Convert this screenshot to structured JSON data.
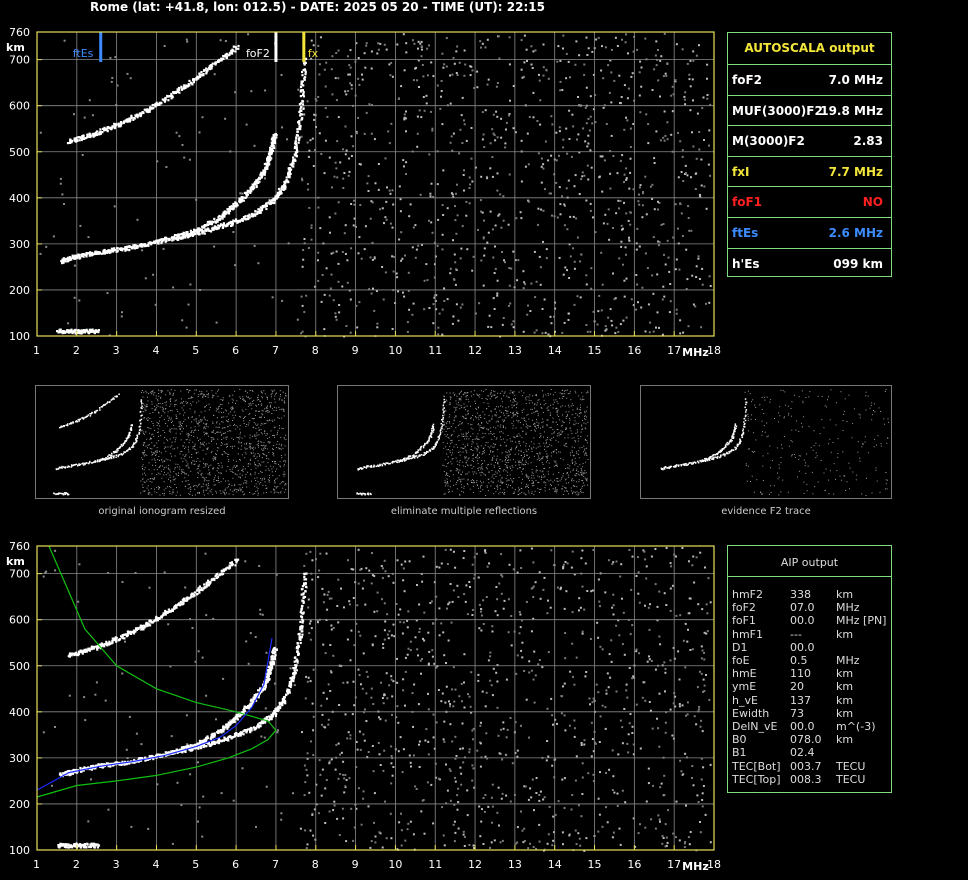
{
  "header": "Rome (lat: +41.8, lon: 012.5) - DATE: 2025 05 20 - TIME (UT): 22:15",
  "colors": {
    "axis": "#e8e05a",
    "grid": "#8a8a8a",
    "panel_border": "#7fdc7f",
    "fxI": "#f3e63a",
    "foF1": "#ff2020",
    "ftEs": "#3d8cff",
    "profile": "#10c010",
    "trace_fit": "#1a2cff"
  },
  "autoscala": {
    "title": "AUTOSCALA output",
    "rows": [
      {
        "label": "foF2",
        "value": "7.0 MHz",
        "color": "#ffffff"
      },
      {
        "label": "MUF(3000)F2",
        "value": "19.8 MHz",
        "color": "#ffffff"
      },
      {
        "label": "M(3000)F2",
        "value": "2.83",
        "color": "#ffffff"
      },
      {
        "label": "fxI",
        "value": "7.7 MHz",
        "color": "#f3e63a"
      },
      {
        "label": "foF1",
        "value": "NO",
        "color": "#ff2020"
      },
      {
        "label": "ftEs",
        "value": "2.6 MHz",
        "color": "#3d8cff"
      },
      {
        "label": "h'Es",
        "value": "099    km",
        "color": "#ffffff"
      }
    ]
  },
  "aip": {
    "title": "AIP output",
    "rows": [
      {
        "p": "hmF2",
        "v": "338",
        "u": "km"
      },
      {
        "p": "foF2",
        "v": "07.0",
        "u": "MHz"
      },
      {
        "p": "foF1",
        "v": "00.0",
        "u": "MHz   [PN]"
      },
      {
        "p": "hmF1",
        "v": "---",
        "u": "km"
      },
      {
        "p": "D1",
        "v": "00.0",
        "u": ""
      },
      {
        "p": "foE",
        "v": "0.5",
        "u": "MHz"
      },
      {
        "p": "hmE",
        "v": "110",
        "u": "km"
      },
      {
        "p": "ymE",
        "v": "20",
        "u": "km"
      },
      {
        "p": "h_vE",
        "v": "137",
        "u": "km"
      },
      {
        "p": "Ewidth",
        "v": "73",
        "u": "km"
      },
      {
        "p": "DelN_vE",
        "v": "00.0",
        "u": "m^(-3)"
      },
      {
        "p": "B0",
        "v": "078.0",
        "u": "km"
      },
      {
        "p": "B1",
        "v": "02.4",
        "u": ""
      },
      {
        "p": "TEC[Bot]",
        "v": "003.7",
        "u": "TECU"
      },
      {
        "p": "TEC[Top]",
        "v": "008.3",
        "u": "TECU"
      }
    ]
  },
  "captions": [
    "original ionogram resized",
    "eliminate multiple reflections",
    "evidence F2 trace"
  ],
  "chart_data": [
    {
      "type": "scatter",
      "name_id": "top-ionogram",
      "title": "",
      "xlabel": "MHz",
      "ylabel": "km",
      "xlim": [
        1,
        18
      ],
      "ylim": [
        100,
        760
      ],
      "xticks": [
        "1",
        "2",
        "3",
        "4",
        "5",
        "6",
        "7",
        "8",
        "9",
        "10",
        "11",
        "12",
        "13",
        "14",
        "15",
        "16",
        "17",
        "18"
      ],
      "yticks": [
        "100",
        "200",
        "300",
        "400",
        "500",
        "600",
        "700",
        "760"
      ],
      "grid": true,
      "markers": [
        {
          "label": "ftEs",
          "x": 2.6,
          "color": "#3d8cff"
        },
        {
          "label": "foF2",
          "x": 7.0,
          "color": "#ffffff"
        },
        {
          "label": "fx",
          "x": 7.7,
          "color": "#f3e63a"
        }
      ],
      "traces": [
        {
          "name": "o-trace",
          "x": [
            1.6,
            2.0,
            2.6,
            3.2,
            3.8,
            4.4,
            5.0,
            5.6,
            6.0,
            6.4,
            6.7,
            6.85,
            6.95
          ],
          "y": [
            265,
            275,
            285,
            292,
            302,
            315,
            332,
            360,
            390,
            425,
            460,
            500,
            540
          ]
        },
        {
          "name": "x-trace",
          "x": [
            4.5,
            5.2,
            5.8,
            6.4,
            6.9,
            7.2,
            7.45,
            7.6,
            7.7
          ],
          "y": [
            315,
            330,
            345,
            365,
            395,
            430,
            490,
            580,
            700
          ]
        },
        {
          "name": "o-multiple",
          "x": [
            1.8,
            2.4,
            3.0,
            3.6,
            4.2,
            4.8,
            5.4,
            6.0
          ],
          "y": [
            525,
            540,
            560,
            585,
            615,
            650,
            690,
            730
          ]
        },
        {
          "name": "Es",
          "x": [
            1.5,
            2.0,
            2.5
          ],
          "y": [
            112,
            112,
            112
          ]
        }
      ]
    },
    {
      "type": "scatter",
      "name_id": "bottom-ionogram",
      "title": "",
      "xlabel": "MHz",
      "ylabel": "km",
      "xlim": [
        1,
        18
      ],
      "ylim": [
        100,
        760
      ],
      "xticks": [
        "1",
        "2",
        "3",
        "4",
        "5",
        "6",
        "7",
        "8",
        "9",
        "10",
        "11",
        "12",
        "13",
        "14",
        "15",
        "16",
        "17",
        "18"
      ],
      "yticks": [
        "100",
        "200",
        "300",
        "400",
        "500",
        "600",
        "700",
        "760"
      ],
      "grid": true,
      "traces": [
        {
          "name": "o-trace",
          "x": [
            1.6,
            2.0,
            2.6,
            3.2,
            3.8,
            4.4,
            5.0,
            5.6,
            6.0,
            6.4,
            6.7,
            6.85,
            6.95
          ],
          "y": [
            265,
            275,
            285,
            292,
            302,
            315,
            332,
            360,
            390,
            425,
            460,
            500,
            540
          ]
        },
        {
          "name": "x-trace",
          "x": [
            4.5,
            5.2,
            5.8,
            6.4,
            6.9,
            7.2,
            7.45,
            7.6,
            7.7
          ],
          "y": [
            315,
            330,
            345,
            365,
            395,
            430,
            490,
            580,
            700
          ]
        },
        {
          "name": "o-multiple",
          "x": [
            1.8,
            2.4,
            3.0,
            3.6,
            4.2,
            4.8,
            5.4,
            6.0
          ],
          "y": [
            525,
            540,
            560,
            585,
            615,
            650,
            690,
            730
          ]
        },
        {
          "name": "Es",
          "x": [
            1.5,
            2.0,
            2.5
          ],
          "y": [
            112,
            112,
            112
          ]
        }
      ],
      "profiles": [
        {
          "name": "density-profile",
          "color": "#10c010",
          "x": [
            1.0,
            2.0,
            3.0,
            4.0,
            5.0,
            5.8,
            6.4,
            6.8,
            7.0,
            6.8,
            6.0,
            5.0,
            4.0,
            3.0,
            2.2,
            1.7,
            1.3
          ],
          "y": [
            215,
            240,
            250,
            262,
            280,
            300,
            320,
            340,
            360,
            380,
            400,
            420,
            450,
            500,
            580,
            680,
            760
          ]
        },
        {
          "name": "fitted-trace",
          "color": "#1a2cff",
          "x": [
            1.0,
            1.8,
            2.6,
            3.4,
            4.2,
            5.0,
            5.6,
            6.0,
            6.4,
            6.7,
            6.9
          ],
          "y": [
            230,
            268,
            282,
            292,
            305,
            325,
            345,
            370,
            410,
            460,
            560
          ]
        }
      ]
    }
  ]
}
